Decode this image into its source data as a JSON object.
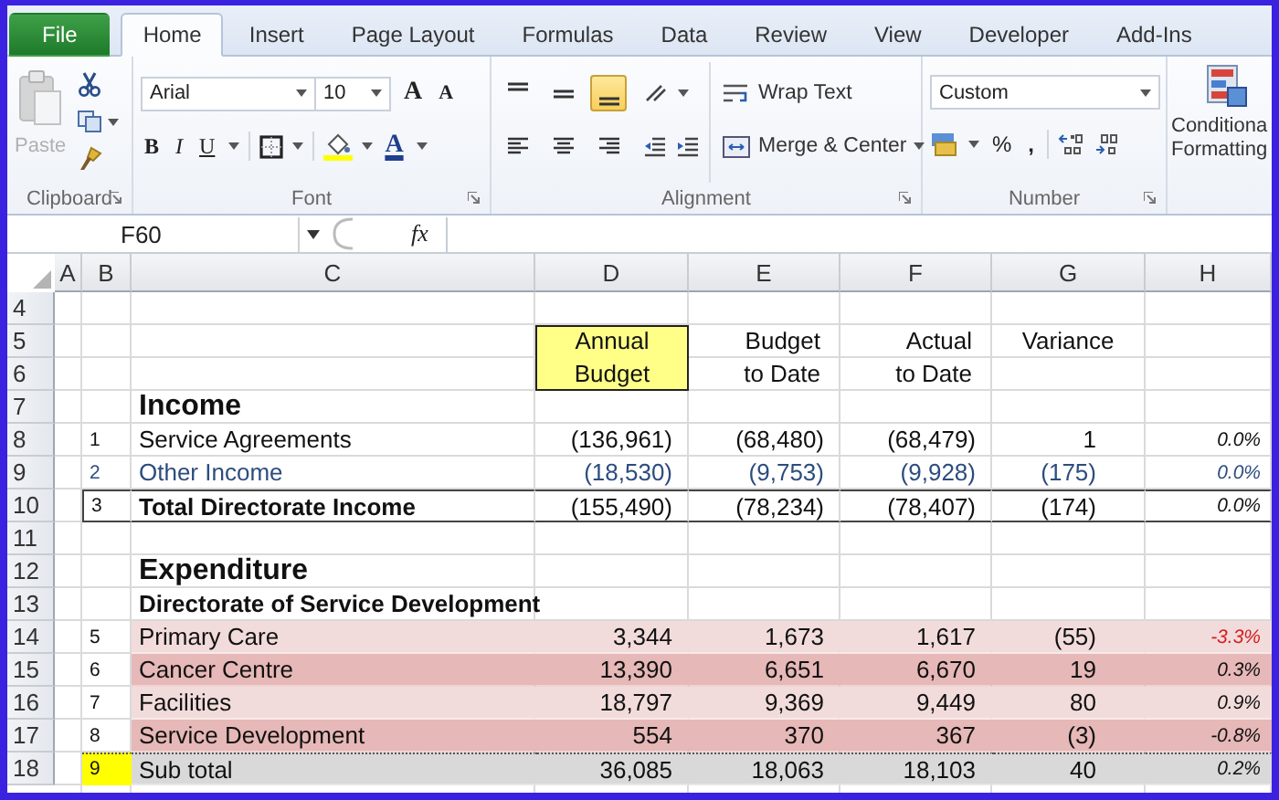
{
  "ribbon": {
    "tabs": [
      {
        "label": "File",
        "kind": "file",
        "selected": false
      },
      {
        "label": "Home",
        "kind": "tab",
        "selected": true
      },
      {
        "label": "Insert",
        "kind": "tab",
        "selected": false
      },
      {
        "label": "Page Layout",
        "kind": "tab",
        "selected": false
      },
      {
        "label": "Formulas",
        "kind": "tab",
        "selected": false
      },
      {
        "label": "Data",
        "kind": "tab",
        "selected": false
      },
      {
        "label": "Review",
        "kind": "tab",
        "selected": false
      },
      {
        "label": "View",
        "kind": "tab",
        "selected": false
      },
      {
        "label": "Developer",
        "kind": "tab",
        "selected": false
      },
      {
        "label": "Add-Ins",
        "kind": "tab",
        "selected": false
      }
    ],
    "clipboard": {
      "paste": "Paste",
      "paste_disabled": true,
      "group": "Clipboard"
    },
    "font": {
      "name": "Arial",
      "size": "10",
      "grow": "A",
      "shrink": "A",
      "bold": "B",
      "italic": "I",
      "underline": "U",
      "color_letter": "A",
      "group": "Font"
    },
    "alignment": {
      "vertical": [
        {
          "kind": "top",
          "selected": false
        },
        {
          "kind": "middle",
          "selected": false
        },
        {
          "kind": "bottom",
          "selected": true
        }
      ],
      "horizontal": [
        {
          "kind": "left",
          "selected": false
        },
        {
          "kind": "center",
          "selected": false
        },
        {
          "kind": "right",
          "selected": false
        }
      ],
      "wrap": "Wrap Text",
      "merge": "Merge & Center",
      "group": "Alignment"
    },
    "number": {
      "format": "Custom",
      "percent": "%",
      "comma": ",",
      "group": "Number"
    },
    "styles": {
      "label_lines": [
        "Conditiona",
        "Formatting"
      ]
    }
  },
  "formula_bar": {
    "name_box": "F60",
    "fx": "fx"
  },
  "sheet": {
    "columns": [
      "A",
      "B",
      "C",
      "D",
      "E",
      "F",
      "G",
      "H"
    ],
    "rows": [
      {
        "number": "4"
      },
      {
        "number": "5",
        "kind": "header",
        "cells": {
          "D": {
            "text": "Annual\nBudget",
            "boxed": true
          },
          "E": "Budget",
          "F": "Actual",
          "G": "Variance"
        }
      },
      {
        "number": "6",
        "kind": "header",
        "cells": {
          "E": "to Date",
          "F": "to Date"
        }
      },
      {
        "number": "7",
        "kind": "heading",
        "cells": {
          "C": "Income"
        }
      },
      {
        "number": "8",
        "kind": "data",
        "cells": {
          "B": "1",
          "C": "Service Agreements",
          "D": "(136,961)",
          "E": "(68,480)",
          "F": "(68,479)",
          "G": "1",
          "H": "0.0%"
        }
      },
      {
        "number": "9",
        "kind": "input",
        "cells": {
          "B": "2",
          "C": "Other Income",
          "D": "(18,530)",
          "E": "(9,753)",
          "F": "(9,928)",
          "G": "(175)",
          "H": "0.0%"
        }
      },
      {
        "number": "10",
        "kind": "total",
        "cells": {
          "B": "3",
          "C": "Total Directorate Income",
          "D": "(155,490)",
          "E": "(78,234)",
          "F": "(78,407)",
          "G": "(174)",
          "H": "0.0%"
        }
      },
      {
        "number": "11"
      },
      {
        "number": "12",
        "kind": "heading",
        "cells": {
          "C": "Expenditure"
        }
      },
      {
        "number": "13",
        "kind": "subheading",
        "cells": {
          "C": "Directorate of Service Development"
        }
      },
      {
        "number": "14",
        "kind": "data",
        "color": "#f2dcdb",
        "cells": {
          "B": "5",
          "C": "Primary Care",
          "D": "3,344",
          "E": "1,673",
          "F": "1,617",
          "G": "(55)",
          "H": {
            "text": "-3.3%",
            "alert": true
          }
        }
      },
      {
        "number": "15",
        "kind": "data",
        "color": "#e6b8b7",
        "cells": {
          "B": "6",
          "C": "Cancer Centre",
          "D": "13,390",
          "E": "6,651",
          "F": "6,670",
          "G": "19",
          "H": "0.3%"
        }
      },
      {
        "number": "16",
        "kind": "data",
        "color": "#f2dcdb",
        "cells": {
          "B": "7",
          "C": "Facilities",
          "D": "18,797",
          "E": "9,369",
          "F": "9,449",
          "G": "80",
          "H": "0.9%"
        }
      },
      {
        "number": "17",
        "kind": "data",
        "color": "#e6b8b7",
        "cells": {
          "B": "8",
          "C": "Service Development",
          "D": "554",
          "E": "370",
          "F": "367",
          "G": "(3)",
          "H": "-0.8%"
        }
      },
      {
        "number": "18",
        "kind": "subtotal",
        "color": "#d9d9d9",
        "cells": {
          "B": {
            "text": "9",
            "marked": true
          },
          "C": "Sub total",
          "D": "36,085",
          "E": "18,063",
          "F": "18,103",
          "G": "40",
          "H": "0.2%"
        }
      }
    ]
  }
}
